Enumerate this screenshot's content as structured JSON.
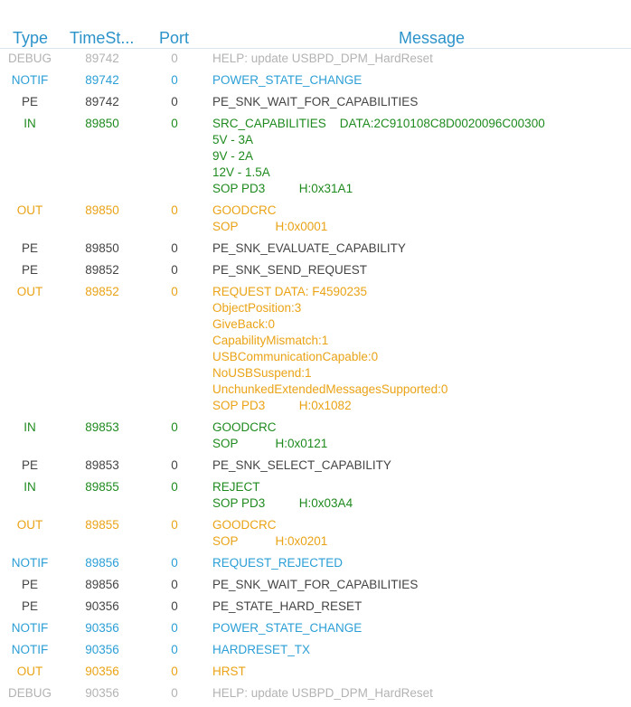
{
  "header": {
    "type": "Type",
    "timestamp": "TimeSt...",
    "port": "Port",
    "message": "Message"
  },
  "colors": {
    "DEBUG": "#b3b3b3",
    "NOTIF": "#2b9fd6",
    "PE": "#444444",
    "IN": "#1e8a1e",
    "OUT": "#eaa316",
    "header": "#2b93c9"
  },
  "rows": [
    {
      "type": "DEBUG",
      "time": "89742",
      "port": "0",
      "lines": [
        "HELP: update USBPD_DPM_HardReset"
      ]
    },
    {
      "type": "NOTIF",
      "time": "89742",
      "port": "0",
      "lines": [
        "POWER_STATE_CHANGE"
      ]
    },
    {
      "type": "PE",
      "time": "89742",
      "port": "0",
      "lines": [
        "PE_SNK_WAIT_FOR_CAPABILITIES"
      ]
    },
    {
      "type": "IN",
      "time": "89850",
      "port": "0",
      "lines": [
        "SRC_CAPABILITIES    DATA:2C910108C8D0020096C00300",
        "5V - 3A",
        "9V - 2A",
        "12V - 1.5A",
        "SOP PD3          H:0x31A1"
      ]
    },
    {
      "type": "OUT",
      "time": "89850",
      "port": "0",
      "lines": [
        "GOODCRC",
        "SOP           H:0x0001"
      ]
    },
    {
      "type": "PE",
      "time": "89850",
      "port": "0",
      "lines": [
        "PE_SNK_EVALUATE_CAPABILITY"
      ]
    },
    {
      "type": "PE",
      "time": "89852",
      "port": "0",
      "lines": [
        "PE_SNK_SEND_REQUEST"
      ]
    },
    {
      "type": "OUT",
      "time": "89852",
      "port": "0",
      "lines": [
        "REQUEST DATA: F4590235",
        "ObjectPosition:3",
        "GiveBack:0",
        "CapabilityMismatch:1",
        "USBCommunicationCapable:0",
        "NoUSBSuspend:1",
        "UnchunkedExtendedMessagesSupported:0",
        "SOP PD3          H:0x1082"
      ]
    },
    {
      "type": "IN",
      "time": "89853",
      "port": "0",
      "lines": [
        "GOODCRC",
        "SOP           H:0x0121"
      ]
    },
    {
      "type": "PE",
      "time": "89853",
      "port": "0",
      "lines": [
        "PE_SNK_SELECT_CAPABILITY"
      ]
    },
    {
      "type": "IN",
      "time": "89855",
      "port": "0",
      "lines": [
        "REJECT",
        "SOP PD3          H:0x03A4"
      ]
    },
    {
      "type": "OUT",
      "time": "89855",
      "port": "0",
      "lines": [
        "GOODCRC",
        "SOP           H:0x0201"
      ]
    },
    {
      "type": "NOTIF",
      "time": "89856",
      "port": "0",
      "lines": [
        "REQUEST_REJECTED"
      ]
    },
    {
      "type": "PE",
      "time": "89856",
      "port": "0",
      "lines": [
        "PE_SNK_WAIT_FOR_CAPABILITIES"
      ]
    },
    {
      "type": "PE",
      "time": "90356",
      "port": "0",
      "lines": [
        "PE_STATE_HARD_RESET"
      ]
    },
    {
      "type": "NOTIF",
      "time": "90356",
      "port": "0",
      "lines": [
        "POWER_STATE_CHANGE"
      ]
    },
    {
      "type": "NOTIF",
      "time": "90356",
      "port": "0",
      "lines": [
        "HARDRESET_TX"
      ]
    },
    {
      "type": "OUT",
      "time": "90356",
      "port": "0",
      "lines": [
        "HRST"
      ]
    },
    {
      "type": "DEBUG",
      "time": "90356",
      "port": "0",
      "lines": [
        "HELP: update USBPD_DPM_HardReset"
      ]
    }
  ]
}
